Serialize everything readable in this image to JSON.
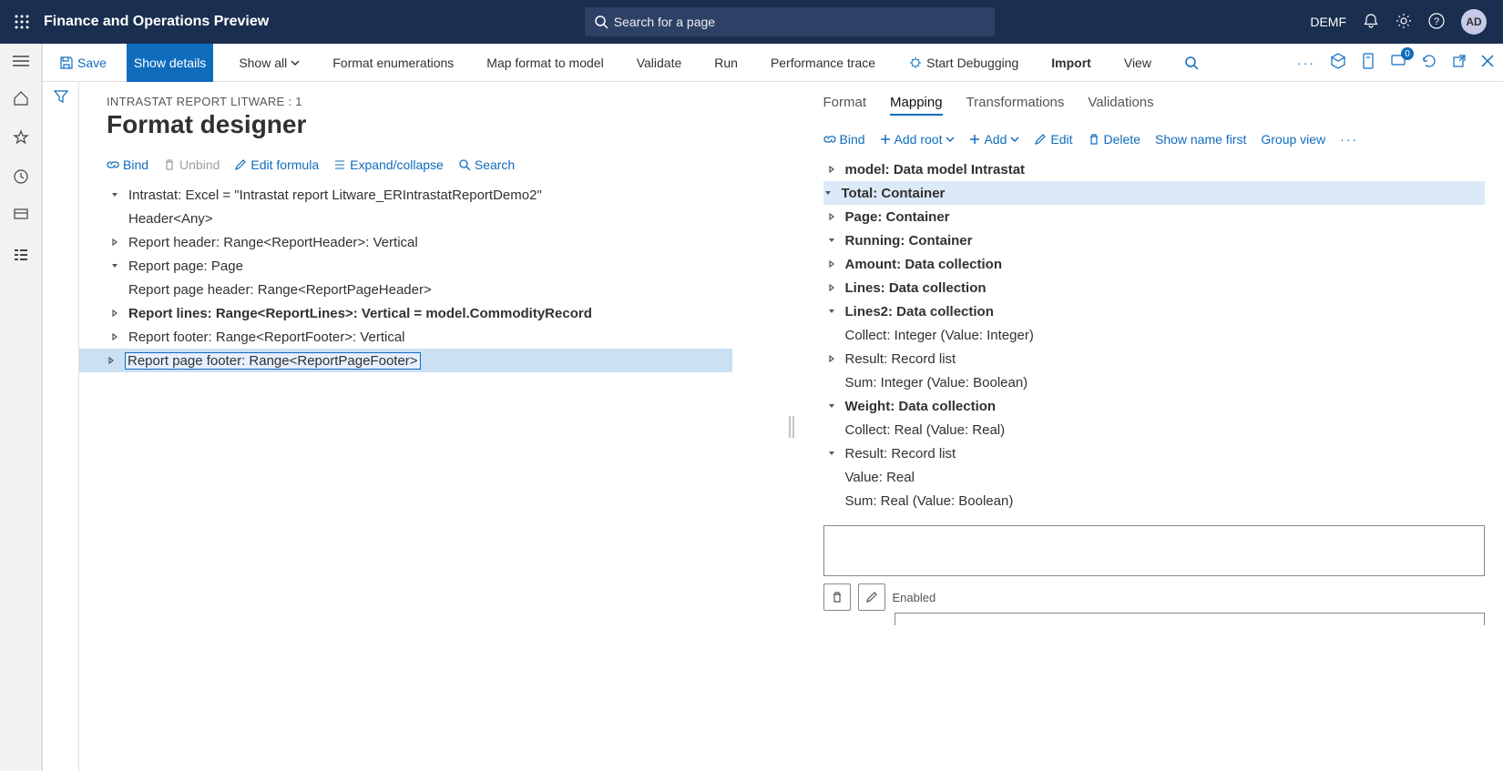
{
  "topbar": {
    "title": "Finance and Operations Preview",
    "search_placeholder": "Search for a page",
    "company": "DEMF",
    "avatar": "AD"
  },
  "actionbar": {
    "save": "Save",
    "show_details": "Show details",
    "show_all": "Show all",
    "format_enum": "Format enumerations",
    "map_format": "Map format to model",
    "validate": "Validate",
    "run": "Run",
    "perf_trace": "Performance trace",
    "start_debug": "Start Debugging",
    "import": "Import",
    "view": "View"
  },
  "page": {
    "breadcrumb": "INTRASTAT REPORT LITWARE : 1",
    "title": "Format designer"
  },
  "left_toolbar": {
    "bind": "Bind",
    "unbind": "Unbind",
    "edit_formula": "Edit formula",
    "expand": "Expand/collapse",
    "search": "Search"
  },
  "left_tree": [
    {
      "indent": 0,
      "caret": "down",
      "bold": false,
      "label": "Intrastat: Excel = \"Intrastat report Litware_ERIntrastatReportDemo2\""
    },
    {
      "indent": 1,
      "caret": "",
      "bold": false,
      "label": "Header<Any>"
    },
    {
      "indent": 1,
      "caret": "right",
      "bold": false,
      "label": "Report header: Range<ReportHeader>: Vertical"
    },
    {
      "indent": 1,
      "caret": "down",
      "bold": false,
      "label": "Report page: Page"
    },
    {
      "indent": 2,
      "caret": "",
      "bold": false,
      "label": "Report page header: Range<ReportPageHeader>"
    },
    {
      "indent": 2,
      "caret": "right",
      "bold": true,
      "label": "Report lines: Range<ReportLines>: Vertical = model.CommodityRecord"
    },
    {
      "indent": 2,
      "caret": "right",
      "bold": false,
      "label": "Report footer: Range<ReportFooter>: Vertical"
    },
    {
      "indent": 2,
      "caret": "right",
      "bold": false,
      "selected": true,
      "label": "Report page footer: Range<ReportPageFooter>"
    }
  ],
  "right_tabs": {
    "format": "Format",
    "mapping": "Mapping",
    "transformations": "Transformations",
    "validations": "Validations"
  },
  "right_toolbar": {
    "bind": "Bind",
    "add_root": "Add root",
    "add": "Add",
    "edit": "Edit",
    "delete": "Delete",
    "show_name_first": "Show name first",
    "group_view": "Group view"
  },
  "right_tree": [
    {
      "indent": 0,
      "caret": "right",
      "bold": true,
      "label": "model: Data model Intrastat"
    },
    {
      "indent": 0,
      "caret": "down",
      "bold": true,
      "highlight": true,
      "label": "Total: Container"
    },
    {
      "indent": 1,
      "caret": "right",
      "bold": true,
      "label": "Page: Container"
    },
    {
      "indent": 1,
      "caret": "down",
      "bold": true,
      "label": "Running: Container"
    },
    {
      "indent": 2,
      "caret": "right",
      "bold": true,
      "label": "Amount: Data collection"
    },
    {
      "indent": 2,
      "caret": "right",
      "bold": true,
      "label": "Lines: Data collection"
    },
    {
      "indent": 2,
      "caret": "down",
      "bold": true,
      "label": "Lines2: Data collection"
    },
    {
      "indent": 3,
      "caret": "",
      "bold": false,
      "label": "Collect: Integer (Value: Integer)"
    },
    {
      "indent": 3,
      "caret": "right",
      "bold": false,
      "label": "Result: Record list"
    },
    {
      "indent": 3,
      "caret": "",
      "bold": false,
      "label": "Sum: Integer (Value: Boolean)"
    },
    {
      "indent": 2,
      "caret": "down",
      "bold": true,
      "label": "Weight: Data collection"
    },
    {
      "indent": 3,
      "caret": "",
      "bold": false,
      "label": "Collect: Real (Value: Real)"
    },
    {
      "indent": 3,
      "caret": "down",
      "bold": false,
      "label": "Result: Record list"
    },
    {
      "indent": 4,
      "caret": "",
      "bold": false,
      "label": "Value: Real"
    },
    {
      "indent": 3,
      "caret": "",
      "bold": false,
      "label": "Sum: Real (Value: Boolean)"
    }
  ],
  "details": {
    "enabled_label": "Enabled"
  }
}
